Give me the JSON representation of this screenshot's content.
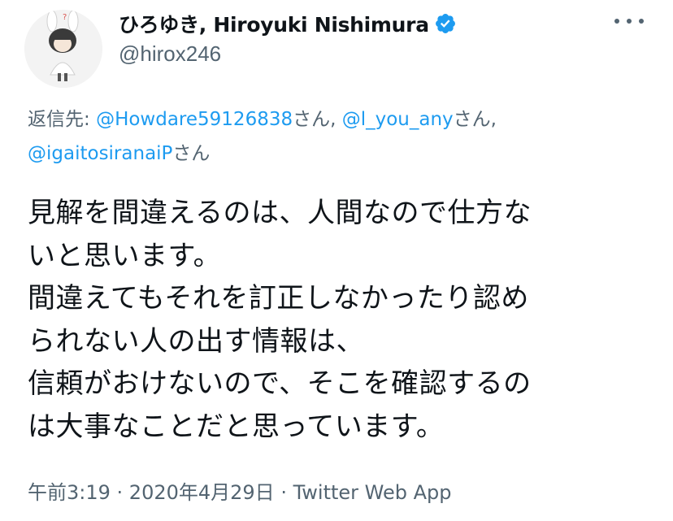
{
  "author": {
    "display_name": "ひろゆき, Hiroyuki Nishimura",
    "handle": "@hirox246",
    "verified_color": "#1d9bf0"
  },
  "reply_to": {
    "prefix": "返信先: ",
    "mentions": [
      {
        "handle": "@Howdare59126838",
        "suffix": "さん, "
      },
      {
        "handle": "@l_you_any",
        "suffix": "さん,"
      },
      {
        "handle": "@igaitosiranaiP",
        "suffix": "さん"
      }
    ]
  },
  "tweet": {
    "lines": [
      "見解を間違えるのは、人間なので仕方な",
      "いと思います。",
      "間違えてもそれを訂正しなかったり認め",
      "られない人の出す情報は、",
      "信頼がおけないので、そこを確認するの",
      "は大事なことだと思っています。"
    ]
  },
  "meta": {
    "time": "午前3:19",
    "separator": " · ",
    "date": "2020年4月29日",
    "source": "Twitter Web App"
  }
}
